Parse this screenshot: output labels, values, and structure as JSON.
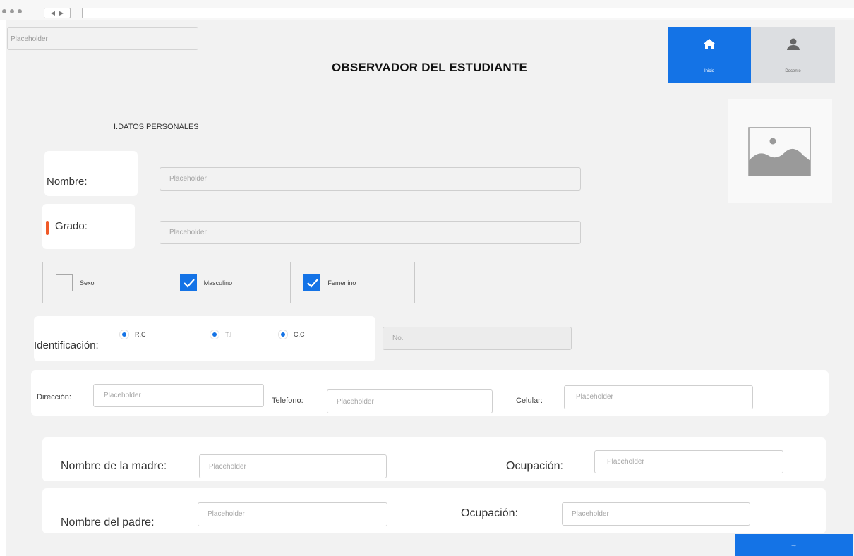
{
  "app": {
    "title": "OBSERVADOR DEL ESTUDIANTE",
    "top_input_placeholder": "Placeholder",
    "colors": {
      "accent": "#1473e6",
      "background": "#f2f2f2",
      "required_mark": "#f05a28"
    }
  },
  "nav": {
    "inicio": {
      "label": "Inicio",
      "icon": "home-icon",
      "active": true
    },
    "docente": {
      "label": "Docente",
      "icon": "user-icon",
      "active": false
    }
  },
  "section": {
    "title": "I.DATOS PERSONALES"
  },
  "form": {
    "nombre": {
      "label": "Nombre:",
      "placeholder": "Placeholder"
    },
    "grado": {
      "label": "Grado:",
      "placeholder": "Placeholder"
    },
    "sexo": {
      "options": [
        {
          "label": "Sexo",
          "checked": false
        },
        {
          "label": "Masculino",
          "checked": true
        },
        {
          "label": "Femenino",
          "checked": true
        }
      ]
    },
    "identificacion": {
      "label": "Identificación:",
      "options": [
        "R.C",
        "T.I",
        "C.C"
      ],
      "number_placeholder": "No."
    },
    "contacto": {
      "direccion": {
        "label": "Dirección:",
        "placeholder": "Placeholder"
      },
      "telefono": {
        "label": "Telefono:",
        "placeholder": "Placeholder"
      },
      "celular": {
        "label": "Celular:",
        "placeholder": "Placeholder"
      }
    },
    "madre": {
      "label": "Nombre de la madre:",
      "placeholder": "Placeholder",
      "ocupacion_label": "Ocupación:",
      "ocupacion_placeholder": "Placeholder"
    },
    "padre": {
      "label": "Nombre del padre:",
      "placeholder": "Placeholder",
      "ocupacion_label": "Ocupación:",
      "ocupacion_placeholder": "Placeholder"
    }
  },
  "next_button": {
    "label": "→",
    "icon": "arrow-right-icon"
  }
}
